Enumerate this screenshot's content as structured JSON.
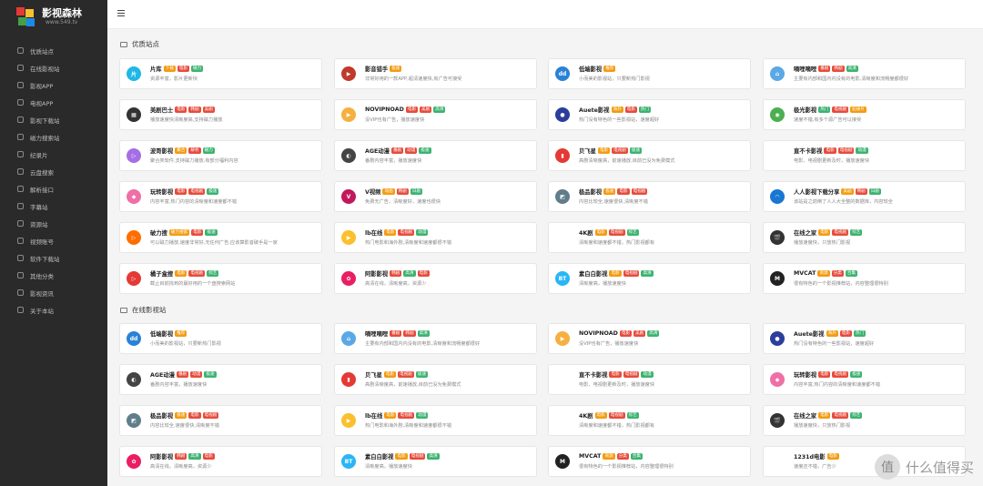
{
  "logo": {
    "title": "影视森林",
    "sub": "www.549.tv"
  },
  "nav": [
    "优质站点",
    "在线影视站",
    "影视APP",
    "电视APP",
    "影视下载站",
    "磁力搜索站",
    "纪录片",
    "云盘搜索",
    "解析接口",
    "字幕站",
    "资源站",
    "视频账号",
    "软件下载站",
    "其他分类",
    "影视资讯",
    "关于本站"
  ],
  "sections": [
    {
      "title": "优质站点"
    },
    {
      "title": "在线影视站"
    }
  ],
  "colors": {
    "red": "#e74c3c",
    "green": "#3cb371",
    "orange": "#f39c12",
    "blue": "#3498db"
  },
  "cards": [
    {
      "name": "片库",
      "tags": [
        [
          "下载",
          "orange"
        ],
        [
          "电影",
          "red"
        ],
        [
          "磁力",
          "green"
        ]
      ],
      "desc": "资源丰富，影片更新快",
      "logo": "片",
      "lc": "#1fb7e6"
    },
    {
      "name": "影音猎手",
      "tags": [
        [
          "极速",
          "orange"
        ]
      ],
      "desc": "非常好用的一款APP,超清速度快,有广告可接受",
      "logo": "▶",
      "lc": "#c0392b"
    },
    {
      "name": "低端影视",
      "tags": [
        [
          "推荐",
          "orange"
        ]
      ],
      "desc": "小而美的影视站，只要新热门影视",
      "logo": "dd",
      "lc": "#2a82d6"
    },
    {
      "name": "嘀哩嘀哩",
      "tags": [
        [
          "番剧",
          "red"
        ],
        [
          "韩剧",
          "red"
        ],
        [
          "高清",
          "green"
        ]
      ],
      "desc": "主要有内部和国内内没有的电影,清晰度和流畅度都很好",
      "logo": "⌂",
      "lc": "#5aa9e6"
    },
    {
      "name": "美剧巴士",
      "tags": [
        [
          "电影",
          "red"
        ],
        [
          "韩剧",
          "red"
        ],
        [
          "美剧",
          "red"
        ]
      ],
      "desc": "播放速度快清晰度高,支持磁力播放",
      "logo": "▦",
      "lc": "#333"
    },
    {
      "name": "NOVIPNOAD",
      "tags": [
        [
          "电影",
          "red"
        ],
        [
          "美剧",
          "red"
        ],
        [
          "高清",
          "green"
        ]
      ],
      "desc": "没VIP也有广告，播放速度快",
      "logo": "▶",
      "lc": "#f5b041"
    },
    {
      "name": "Auete影视",
      "tags": [
        [
          "海外",
          "orange"
        ],
        [
          "电影",
          "red"
        ],
        [
          "热门",
          "green"
        ]
      ],
      "desc": "热门没有特色的一些影视站，速度超好",
      "logo": "●",
      "lc": "#2c3e9c"
    },
    {
      "name": "极光影视",
      "tags": [
        [
          "热门",
          "green"
        ],
        [
          "电视剧",
          "red"
        ],
        [
          "纪录片",
          "orange"
        ]
      ],
      "desc": "速度不错,有多个源广告可以接受",
      "logo": "◉",
      "lc": "#4caf50"
    },
    {
      "name": "波哥影视",
      "tags": [
        [
          "聚合",
          "orange"
        ],
        [
          "解析",
          "red"
        ],
        [
          "磁力",
          "green"
        ]
      ],
      "desc": "聚合类软件,支持磁力播放,有部分福利内容",
      "logo": "▷",
      "lc": "#a66ee6"
    },
    {
      "name": "AGE动漫",
      "tags": [
        [
          "番剧",
          "red"
        ],
        [
          "动漫",
          "red"
        ],
        [
          "极速",
          "green"
        ]
      ],
      "desc": "番剧内容丰富，播放速度快",
      "logo": "◐",
      "lc": "#444"
    },
    {
      "name": "贝飞星",
      "tags": [
        [
          "电影",
          "orange"
        ],
        [
          "电视剧",
          "red"
        ],
        [
          "极速",
          "green"
        ]
      ],
      "desc": "高剧清晰度高，前速播放,目前已没为免费模式",
      "logo": "▮",
      "lc": "#e53935"
    },
    {
      "name": "直不卡影视",
      "tags": [
        [
          "电影",
          "red"
        ],
        [
          "电视剧",
          "red"
        ],
        [
          "动漫",
          "green"
        ]
      ],
      "desc": "电影、电视剧更新及时，播放速度快",
      "logo": "",
      "lc": "#fff"
    },
    {
      "name": "玩转影视",
      "tags": [
        [
          "电影",
          "red"
        ],
        [
          "电视剧",
          "red"
        ],
        [
          "极速",
          "green"
        ]
      ],
      "desc": "内容丰富,热门内容的清晰度和速度都不错",
      "logo": "◆",
      "lc": "#ef6fa6"
    },
    {
      "name": "V视频",
      "tags": [
        [
          "动画",
          "orange"
        ],
        [
          "韩剧",
          "red"
        ],
        [
          "日剧",
          "green"
        ]
      ],
      "desc": "免费无广告，清晰度好，速度也很快",
      "logo": "V",
      "lc": "#c2185b"
    },
    {
      "name": "极品影视",
      "tags": [
        [
          "极速",
          "orange"
        ],
        [
          "电影",
          "red"
        ],
        [
          "电视剧",
          "red"
        ]
      ],
      "desc": "内容比较全,速度很快,清晰度不错",
      "logo": "◩",
      "lc": "#607d8b"
    },
    {
      "name": "人人影视下载分享",
      "tags": [
        [
          "美剧",
          "orange"
        ],
        [
          "韩剧",
          "red"
        ],
        [
          "日剧",
          "green"
        ]
      ],
      "desc": "该站是之前倒了人人大全整的数据库，内容较全",
      "logo": "◠",
      "lc": "#1976d2"
    },
    {
      "name": "破力搜",
      "tags": [
        [
          "破力搜索",
          "orange"
        ],
        [
          "电影",
          "red"
        ],
        [
          "极速",
          "green"
        ]
      ],
      "desc": "可以磁力播放,速度非常好,无任何广告,应该算影音破手是一家",
      "logo": "▷",
      "lc": "#ff6d00"
    },
    {
      "name": "lb在线",
      "tags": [
        [
          "电影",
          "orange"
        ],
        [
          "电视剧",
          "red"
        ],
        [
          "动漫",
          "green"
        ]
      ],
      "desc": "热门电影和海外剧,清晰度和速度都很不错",
      "logo": "▶",
      "lc": "#fbc02d"
    },
    {
      "name": "4K剧",
      "tags": [
        [
          "电影",
          "orange"
        ],
        [
          "电视剧",
          "red"
        ],
        [
          "综艺",
          "green"
        ]
      ],
      "desc": "清晰度和速度都不错，热门影视都有",
      "logo": "",
      "lc": "#fff"
    },
    {
      "name": "在线之家",
      "tags": [
        [
          "电影",
          "orange"
        ],
        [
          "电视剧",
          "red"
        ],
        [
          "综艺",
          "green"
        ]
      ],
      "desc": "播放速度快，只放热门影视",
      "logo": "🎬",
      "lc": "#333"
    },
    {
      "name": "橘子盒搜",
      "tags": [
        [
          "电影",
          "orange"
        ],
        [
          "电视剧",
          "red"
        ],
        [
          "综艺",
          "green"
        ]
      ],
      "desc": "截止目前找到的最好用的一个盘搜索网站",
      "logo": "▷",
      "lc": "#e53935"
    },
    {
      "name": "阿影影视",
      "tags": [
        [
          "韩剧",
          "red"
        ],
        [
          "高清",
          "green"
        ],
        [
          "电影",
          "red"
        ]
      ],
      "desc": "高清在线，清晰度高，资源少",
      "logo": "✿",
      "lc": "#e91e63"
    },
    {
      "name": "素白白影视",
      "tags": [
        [
          "电影",
          "orange"
        ],
        [
          "电视剧",
          "red"
        ],
        [
          "高清",
          "green"
        ]
      ],
      "desc": "清晰度高，播放速度快",
      "logo": "BT",
      "lc": "#29b6f6"
    },
    {
      "name": "MVCAT",
      "tags": [
        [
          "资源",
          "orange"
        ],
        [
          "分类",
          "red"
        ],
        [
          "合集",
          "green"
        ]
      ],
      "desc": "很有特色的一个影视推荐站，内容整理很特别",
      "logo": "M",
      "lc": "#222"
    },
    {
      "name": "低端影视",
      "tags": [
        [
          "推荐",
          "orange"
        ]
      ],
      "desc": "小而美的影视站，只要新热门影视",
      "logo": "dd",
      "lc": "#2a82d6"
    },
    {
      "name": "嘀哩嘀哩",
      "tags": [
        [
          "番剧",
          "red"
        ],
        [
          "韩剧",
          "red"
        ],
        [
          "高清",
          "green"
        ]
      ],
      "desc": "主要有内部和国内内没有的电影,清晰度和流畅度都很好",
      "logo": "⌂",
      "lc": "#5aa9e6"
    },
    {
      "name": "NOVIPNOAD",
      "tags": [
        [
          "电影",
          "red"
        ],
        [
          "美剧",
          "red"
        ],
        [
          "高清",
          "green"
        ]
      ],
      "desc": "没VIP也有广告，播放速度快",
      "logo": "▶",
      "lc": "#f5b041"
    },
    {
      "name": "Auete影视",
      "tags": [
        [
          "海外",
          "orange"
        ],
        [
          "电影",
          "red"
        ],
        [
          "热门",
          "green"
        ]
      ],
      "desc": "热门没有特色的一些影视站，速度超好",
      "logo": "●",
      "lc": "#2c3e9c"
    },
    {
      "name": "AGE动漫",
      "tags": [
        [
          "番剧",
          "red"
        ],
        [
          "动漫",
          "red"
        ],
        [
          "极速",
          "green"
        ]
      ],
      "desc": "番剧内容丰富，播放速度快",
      "logo": "◐",
      "lc": "#444"
    },
    {
      "name": "贝飞星",
      "tags": [
        [
          "电影",
          "orange"
        ],
        [
          "电视剧",
          "red"
        ],
        [
          "极速",
          "green"
        ]
      ],
      "desc": "高剧清晰度高，前速播放,目前已没为免费模式",
      "logo": "▮",
      "lc": "#e53935"
    },
    {
      "name": "直不卡影视",
      "tags": [
        [
          "电影",
          "red"
        ],
        [
          "电视剧",
          "red"
        ],
        [
          "动漫",
          "green"
        ]
      ],
      "desc": "电影、电视剧更新及时，播放速度快",
      "logo": "",
      "lc": "#fff"
    },
    {
      "name": "玩转影视",
      "tags": [
        [
          "电影",
          "red"
        ],
        [
          "电视剧",
          "red"
        ],
        [
          "极速",
          "green"
        ]
      ],
      "desc": "内容丰富,热门内容的清晰度和速度都不错",
      "logo": "◆",
      "lc": "#ef6fa6"
    },
    {
      "name": "极品影视",
      "tags": [
        [
          "极速",
          "orange"
        ],
        [
          "电影",
          "red"
        ],
        [
          "电视剧",
          "red"
        ]
      ],
      "desc": "内容比较全,速度很快,清晰度不错",
      "logo": "◩",
      "lc": "#607d8b"
    },
    {
      "name": "lb在线",
      "tags": [
        [
          "电影",
          "orange"
        ],
        [
          "电视剧",
          "red"
        ],
        [
          "动漫",
          "green"
        ]
      ],
      "desc": "热门电影和海外剧,清晰度和速度都很不错",
      "logo": "▶",
      "lc": "#fbc02d"
    },
    {
      "name": "4K剧",
      "tags": [
        [
          "电影",
          "orange"
        ],
        [
          "电视剧",
          "red"
        ],
        [
          "综艺",
          "green"
        ]
      ],
      "desc": "清晰度和速度都不错，热门影视都有",
      "logo": "",
      "lc": "#fff"
    },
    {
      "name": "在线之家",
      "tags": [
        [
          "电影",
          "orange"
        ],
        [
          "电视剧",
          "red"
        ],
        [
          "综艺",
          "green"
        ]
      ],
      "desc": "播放速度快，只放热门影视",
      "logo": "🎬",
      "lc": "#333"
    },
    {
      "name": "阿影影视",
      "tags": [
        [
          "韩剧",
          "red"
        ],
        [
          "高清",
          "green"
        ],
        [
          "电影",
          "red"
        ]
      ],
      "desc": "高清在线，清晰度高，资源少",
      "logo": "✿",
      "lc": "#e91e63"
    },
    {
      "name": "素白白影视",
      "tags": [
        [
          "电影",
          "orange"
        ],
        [
          "电视剧",
          "red"
        ],
        [
          "高清",
          "green"
        ]
      ],
      "desc": "清晰度高，播放速度快",
      "logo": "BT",
      "lc": "#29b6f6"
    },
    {
      "name": "MVCAT",
      "tags": [
        [
          "资源",
          "orange"
        ],
        [
          "分类",
          "red"
        ],
        [
          "合集",
          "green"
        ]
      ],
      "desc": "很有特色的一个影视推荐站，内容整理很特别",
      "logo": "M",
      "lc": "#222"
    },
    {
      "name": "1231d电影",
      "tags": [
        [
          "电影",
          "orange"
        ]
      ],
      "desc": "速度还不错，广告少",
      "logo": "",
      "lc": "#fff"
    }
  ],
  "watermark": "什么值得买"
}
